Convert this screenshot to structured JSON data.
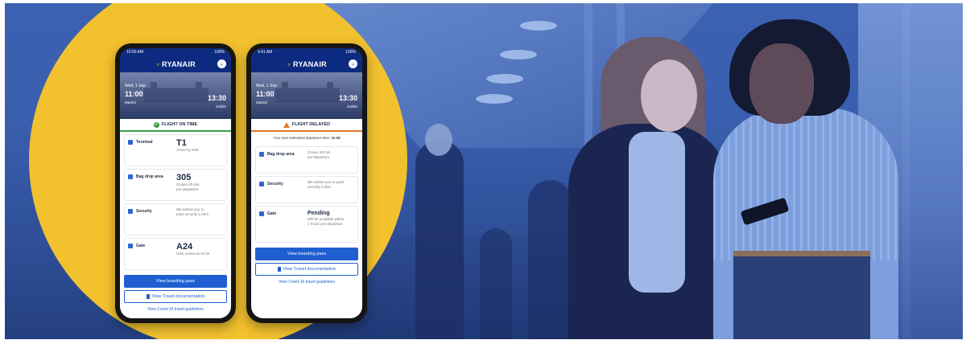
{
  "colors": {
    "accent_yellow": "#f2c12e",
    "brand_blue": "#0b2a80",
    "on_time_green": "#3aa14a",
    "delayed_orange": "#e2792b"
  },
  "icons": {
    "logo": "harp-icon",
    "status_ok": "check-icon",
    "status_delayed": "warning-icon"
  },
  "phone_left": {
    "status_time": "10:00 AM",
    "status_battery": "100%",
    "brand": "RYANAIR",
    "date": "Wed, 1 Sep",
    "departure_time": "11:00",
    "arrival_time": "13:30",
    "from": "Madrid",
    "to": "Dublin",
    "flight_status": "FLIGHT ON TIME",
    "rows": [
      {
        "label": "Terminal",
        "value": "T1",
        "sub1": "Arrive by 9:00",
        "sub2": ""
      },
      {
        "label": "Bag drop area",
        "value": "305",
        "sub1": "Closes 40 min",
        "sub2": "pre-departure"
      },
      {
        "label": "Security",
        "value": "",
        "sub1": "We advise you to",
        "sub2": "pass security 1.5hrs"
      },
      {
        "label": "Gate",
        "value": "A24",
        "sub1": "Gate closes at 10:30",
        "sub2": ""
      }
    ],
    "primary_button": "View boarding pass",
    "secondary_button": "View Travel documentation",
    "link": "View Covid-19 travel guidelines"
  },
  "phone_right": {
    "status_time": "9:41 AM",
    "status_battery": "100%",
    "brand": "RYANAIR",
    "date": "Wed, 1 Sep",
    "departure_time": "11:00",
    "arrival_time": "13:30",
    "from": "Madrid",
    "to": "Dublin",
    "flight_status": "FLIGHT DELAYED",
    "estimate_text": "Your new estimated departure time:",
    "estimate_time": "11:30",
    "rows": [
      {
        "label": "Bag drop area",
        "value": "",
        "sub1": "Closes 40 min",
        "sub2": "pre-departure"
      },
      {
        "label": "Security",
        "value": "",
        "sub1": "We advise you to pass",
        "sub2": "security 1.5hrs"
      },
      {
        "label": "Gate",
        "value": "Pending",
        "sub1": "Will be available within",
        "sub2": "2 hours pre-departure"
      }
    ],
    "primary_button": "View boarding pass",
    "secondary_button": "View Travel documentation",
    "link": "View Covid-19 travel guidelines"
  }
}
